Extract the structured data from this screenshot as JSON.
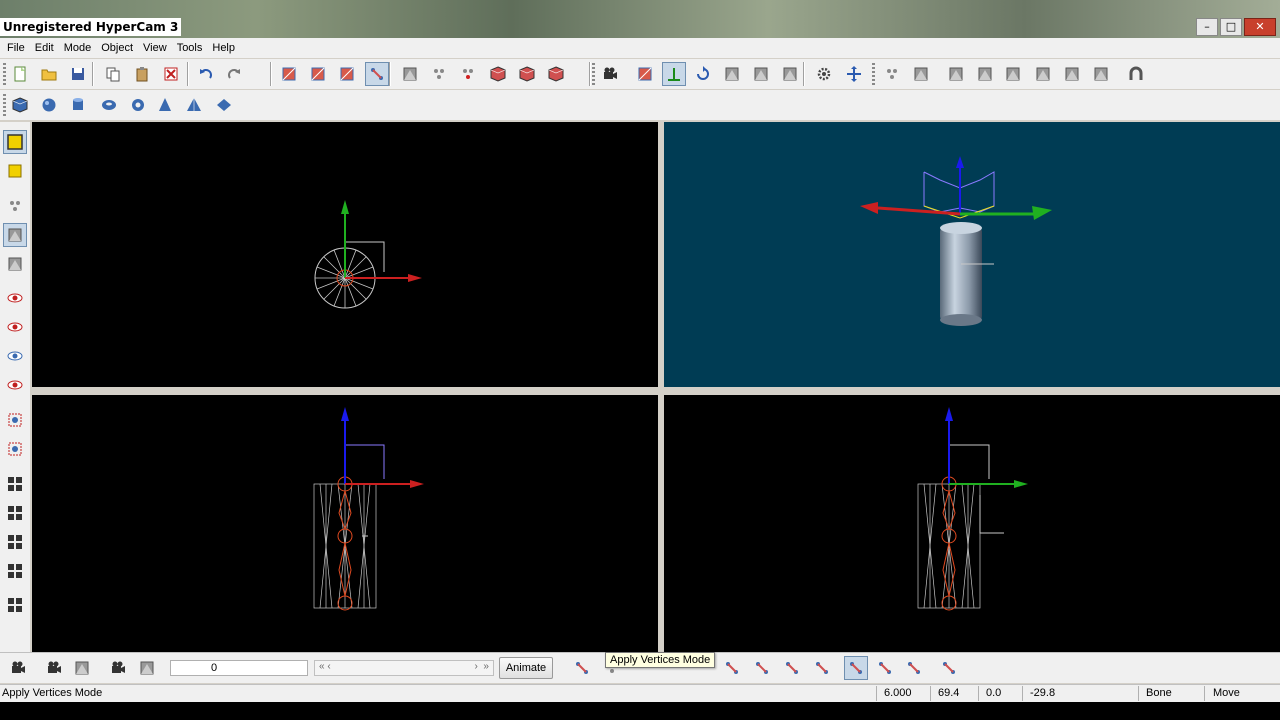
{
  "window": {
    "watermark": "Unregistered HyperCam 3",
    "buttons": [
      "–",
      "□",
      "✕"
    ]
  },
  "menu": [
    "File",
    "Edit",
    "Mode",
    "Object",
    "View",
    "Tools",
    "Help"
  ],
  "toolbar1_icons": [
    "new-icon",
    "open-icon",
    "save-icon",
    "copy-icon",
    "paste-icon",
    "delete-icon",
    "undo-icon",
    "redo-icon",
    "select-face-icon",
    "select-edge-icon",
    "select-poly-icon",
    "select-bone-icon",
    "magic-wand-icon",
    "vertex-dots-icon",
    "vertex-red-icon",
    "red-cube-icon",
    "red-cube-2-icon",
    "red-cube-3-icon",
    "camera-icon",
    "select-box-icon",
    "move-axis-icon",
    "rotate-icon",
    "scale-shield-icon",
    "mirror-icon",
    "flip-icon",
    "gear-icon",
    "move-cross-icon",
    "add-vertex-icon",
    "add-face-icon",
    "bevel-icon",
    "extrude-icon",
    "grid-icon",
    "arrow-right-icon",
    "weld-icon",
    "fan-icon",
    "magnet-icon"
  ],
  "toolbar2_icons": [
    "cube-prim-icon",
    "sphere-prim-icon",
    "cylinder-prim-icon",
    "torus-prim-icon",
    "ring-prim-icon",
    "cone-prim-icon",
    "pyramid-prim-icon",
    "diamond-prim-icon"
  ],
  "left_icons": [
    "object-mode-icon",
    "face-mode-icon",
    "vertex-mode-icon",
    "uv-mode-icon",
    "bone-mode-icon",
    "eye-red-icon",
    "eye-red-2-icon",
    "eye-blue-icon",
    "eye-hide-icon",
    "select-vertices-icon",
    "select-vertices-2-icon",
    "layout-1-icon",
    "layout-2-icon",
    "layout-3-icon",
    "layout-4-icon",
    "layout-5-icon"
  ],
  "timeline": {
    "frame": "0",
    "animate_label": "Animate"
  },
  "tooltip": "Apply Vertices Mode",
  "status": {
    "message": "Apply Vertices Mode",
    "v1": "6.000",
    "v2": "69.4",
    "v3": "0.0",
    "v4": "-29.8",
    "mode": "Bone",
    "tool": "Move"
  },
  "colors": {
    "viewport_bg": "#000000",
    "viewport_3d_bg": "#003c54",
    "axis_x": "#cc2020",
    "axis_y": "#20b020",
    "axis_z": "#1a1aee",
    "wire": "#c8c8c8",
    "bone": "#e04a20"
  }
}
